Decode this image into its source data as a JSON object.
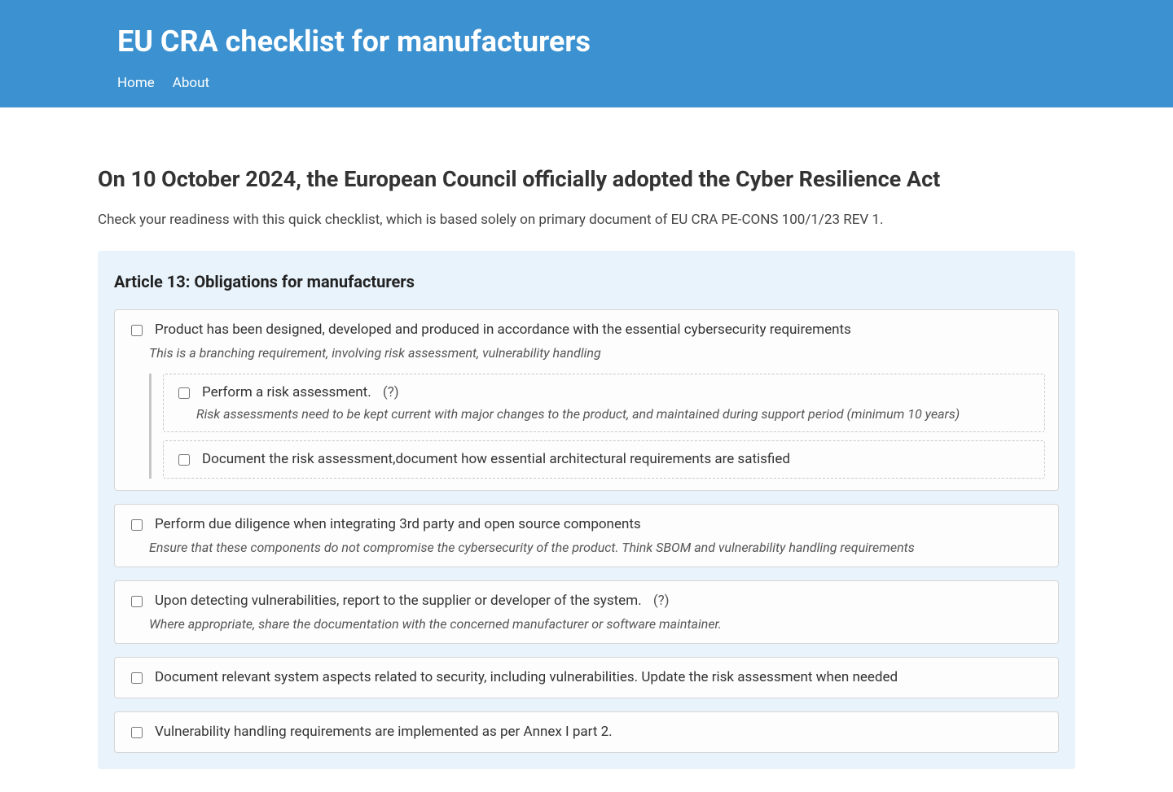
{
  "header": {
    "title": "EU CRA checklist for manufacturers",
    "nav": {
      "home": "Home",
      "about": "About"
    }
  },
  "page": {
    "heading": "On 10 October 2024, the European Council officially adopted the Cyber Resilience Act",
    "subtext": "Check your readiness with this quick checklist, which is based solely on primary document of EU CRA PE-CONS 100/1/23 REV 1."
  },
  "article": {
    "title": "Article 13: Obligations for manufacturers",
    "items": [
      {
        "label": "Product has been designed, developed and produced in accordance with the essential cybersecurity requirements",
        "note": "This is a branching requirement, involving risk assessment, vulnerability handling",
        "has_qmark": false,
        "subitems": [
          {
            "label": "Perform a risk assessment.",
            "has_qmark": true,
            "note": "Risk assessments need to be kept current with major changes to the product, and maintained during support period (minimum 10 years)"
          },
          {
            "label": "Document the risk assessment,document how essential architectural requirements are satisfied",
            "has_qmark": false,
            "note": ""
          }
        ]
      },
      {
        "label": "Perform due diligence when integrating 3rd party and open source components",
        "note": "Ensure that these components do not compromise the cybersecurity of the product. Think SBOM and vulnerability handling requirements",
        "has_qmark": false,
        "subitems": []
      },
      {
        "label": "Upon detecting vulnerabilities, report to the supplier or developer of the system.",
        "note": "Where appropriate, share the documentation with the concerned manufacturer or software maintainer.",
        "has_qmark": true,
        "subitems": []
      },
      {
        "label": "Document relevant system aspects related to security, including vulnerabilities. Update the risk assessment when needed",
        "note": "",
        "has_qmark": false,
        "subitems": []
      },
      {
        "label": "Vulnerability handling requirements are implemented as per Annex I part 2.",
        "note": "",
        "has_qmark": false,
        "subitems": []
      }
    ]
  },
  "qmark_text": "(?)"
}
